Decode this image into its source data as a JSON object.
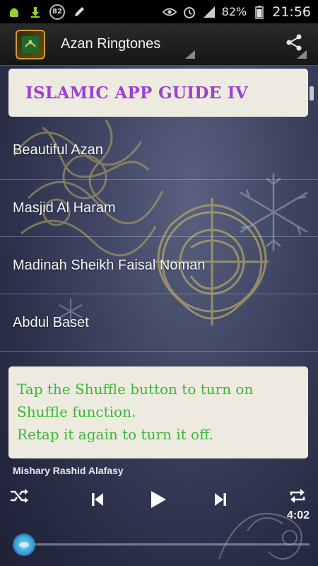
{
  "status_bar": {
    "battery_ring_value": "82",
    "battery_percent": "82%",
    "clock": "21:56",
    "icons": [
      "android-debug-icon",
      "download-icon",
      "battery-ring-icon",
      "pencil-icon",
      "eye-icon",
      "alarm-icon",
      "signal-icon",
      "battery-icon"
    ]
  },
  "action_bar": {
    "title": "Azan Ringtones",
    "app_icon": "quran-book-icon",
    "share_icon": "share-icon"
  },
  "banner": {
    "text": "ISLAMIC APP GUIDE IV"
  },
  "ringtones": [
    {
      "label": "Beautiful Azan"
    },
    {
      "label": "Masjid Al Haram"
    },
    {
      "label": "Madinah Sheikh Faisal Noman"
    },
    {
      "label": "Abdul Baset"
    }
  ],
  "tip": {
    "line1": "Tap the Shuffle button to turn on",
    "line2": "Shuffle function.",
    "line3": "Retap it again to turn it off."
  },
  "player": {
    "artist": "Mishary Rashid Alafasy",
    "duration": "4:02",
    "progress": 0.0,
    "icons": [
      "shuffle-icon",
      "previous-icon",
      "play-icon",
      "next-icon",
      "repeat-icon"
    ]
  },
  "colors": {
    "banner_text": "#9b40d0",
    "tip_text": "#3db53a",
    "seek_thumb": "#3aa2dc"
  }
}
